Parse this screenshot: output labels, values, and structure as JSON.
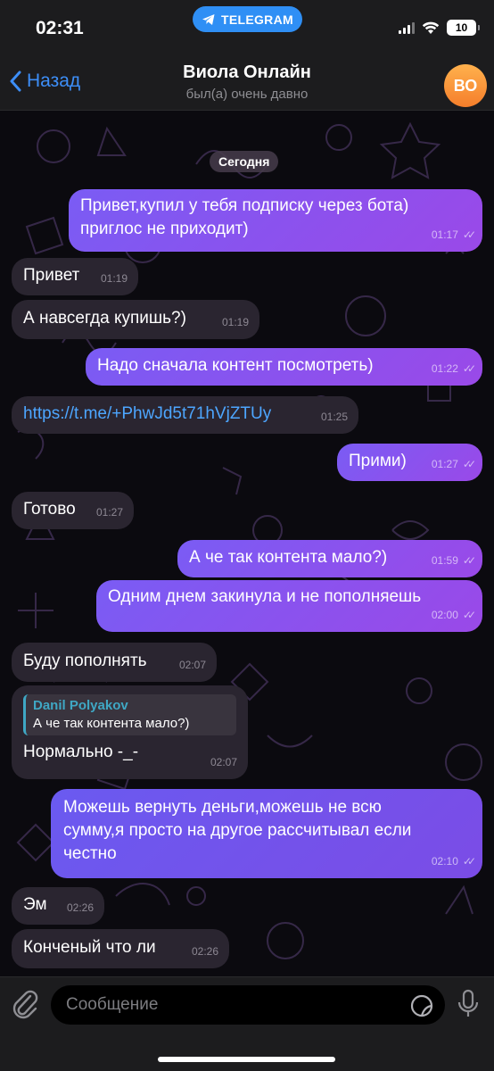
{
  "status_bar": {
    "time": "02:31",
    "app_pill": "TELEGRAM",
    "battery": "10"
  },
  "header": {
    "back_label": "Назад",
    "title": "Виола Онлайн",
    "subtitle": "был(а) очень давно",
    "avatar_initials": "ВО"
  },
  "chat": {
    "date_label": "Сегодня",
    "messages": [
      {
        "dir": "out",
        "lines": [
          "Привет,купил у тебя подписку через бота)",
          "приглос не приходит)"
        ],
        "time": "01:17"
      },
      {
        "dir": "in",
        "text": "Привет",
        "time": "01:19"
      },
      {
        "dir": "in",
        "text": "А навсегда купишь?)",
        "time": "01:19"
      },
      {
        "dir": "out",
        "text": "Надо сначала контент посмотреть)",
        "time": "01:22"
      },
      {
        "dir": "in",
        "link": "https://t.me/+PhwJd5t71hVjZTUy",
        "time": "01:25"
      },
      {
        "dir": "out",
        "text": "Прими)",
        "time": "01:27"
      },
      {
        "dir": "in",
        "text": "Готово",
        "time": "01:27"
      },
      {
        "dir": "out",
        "text": "А че так контента мало?)",
        "time": "01:59"
      },
      {
        "dir": "out",
        "text": "Одним днем закинула и не пополняешь",
        "time": "02:00"
      },
      {
        "dir": "in",
        "text": "Буду пополнять",
        "time": "02:07"
      },
      {
        "dir": "in",
        "reply_name": "Danil Polyakov",
        "reply_text": "А че так контента мало?)",
        "text": "Нормально -_-",
        "time": "02:07"
      },
      {
        "dir": "out",
        "lines": [
          "Можешь вернуть деньги,можешь не всю",
          "сумму,я просто на другое рассчитывал если",
          "честно"
        ],
        "time": "02:10"
      },
      {
        "dir": "in",
        "text": "Эм",
        "time": "02:26"
      },
      {
        "dir": "in",
        "text": "Конченый что ли",
        "time": "02:26"
      }
    ]
  },
  "composer": {
    "placeholder": "Сообщение"
  },
  "colors": {
    "accent": "#3d8ef7",
    "outgoing": "#8a52ee",
    "incoming": "#2a2530",
    "avatar": "#f79a3c"
  }
}
